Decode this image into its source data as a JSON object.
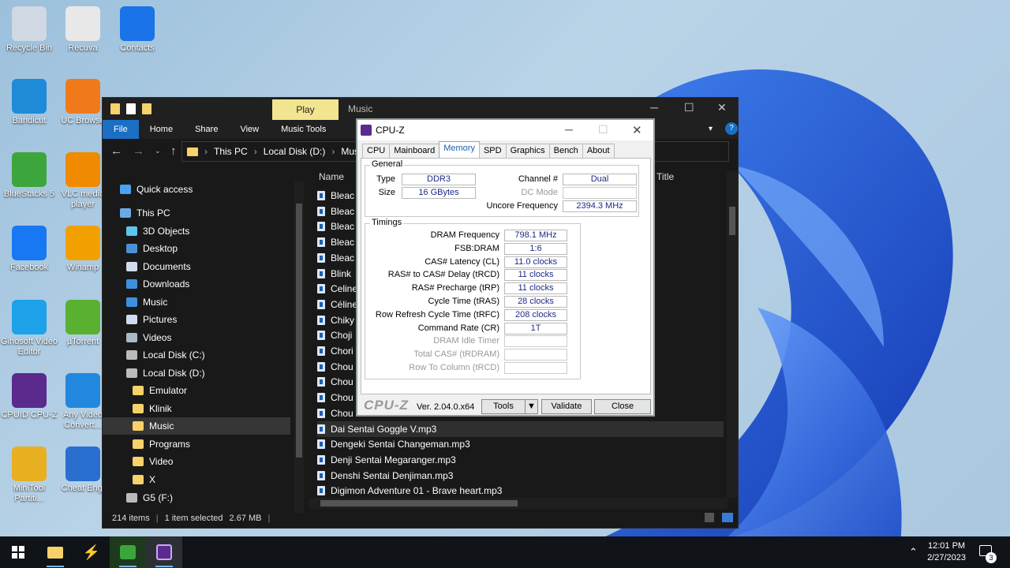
{
  "desktop": {
    "icons": [
      {
        "label": "Recycle Bin",
        "icon": "recycle-bin-icon",
        "color": "#cfd8e3"
      },
      {
        "label": "Recuva",
        "icon": "recuva-icon",
        "color": "#e8e8e8"
      },
      {
        "label": "Contacts",
        "icon": "contacts-icon",
        "color": "#1a73e8"
      },
      {
        "label": "Bandicut",
        "icon": "bandicut-icon",
        "color": "#1f8ad8"
      },
      {
        "label": "UC Browse",
        "icon": "uc-browser-icon",
        "color": "#f07a1a"
      },
      {
        "label": "BlueStacks 5",
        "icon": "bluestacks-icon",
        "color": "#3ca63c"
      },
      {
        "label": "VLC media player",
        "icon": "vlc-icon",
        "color": "#f08a00"
      },
      {
        "label": "Facebook",
        "icon": "facebook-icon",
        "color": "#1877f2"
      },
      {
        "label": "Winamp",
        "icon": "winamp-icon",
        "color": "#f2a000"
      },
      {
        "label": "Gihosoft Video Editor",
        "icon": "gihosoft-icon",
        "color": "#1da1e8"
      },
      {
        "label": "µTorrent",
        "icon": "utorrent-icon",
        "color": "#5ab031"
      },
      {
        "label": "CPUID CPU-Z",
        "icon": "cpuz-icon",
        "color": "#5a2a8c"
      },
      {
        "label": "Any Video Convert...",
        "icon": "any-video-converter-icon",
        "color": "#2288dd"
      },
      {
        "label": "MiniTool Partiti...",
        "icon": "minitool-icon",
        "color": "#e8b020"
      },
      {
        "label": "Cheat Engi",
        "icon": "cheat-engine-icon",
        "color": "#2a6fd0"
      }
    ]
  },
  "explorer": {
    "contextual_tab": "Play",
    "title": "Music",
    "ribbon_tabs": [
      "File",
      "Home",
      "Share",
      "View",
      "Music Tools"
    ],
    "address_parts": [
      "This PC",
      "Local Disk (D:)",
      "Music"
    ],
    "nav": [
      {
        "label": "Quick access",
        "icon": "star-icon",
        "color": "#4aa3f0"
      },
      {
        "label": "This PC",
        "icon": "computer-icon",
        "color": "#6aa9e8"
      },
      {
        "label": "3D Objects",
        "icon": "cube-icon",
        "color": "#5fc4ee"
      },
      {
        "label": "Desktop",
        "icon": "desktop-icon",
        "color": "#4a90d9"
      },
      {
        "label": "Documents",
        "icon": "document-icon",
        "color": "#cfdcef"
      },
      {
        "label": "Downloads",
        "icon": "download-icon",
        "color": "#3f8fe0"
      },
      {
        "label": "Music",
        "icon": "music-icon",
        "color": "#3f8fe0"
      },
      {
        "label": "Pictures",
        "icon": "picture-icon",
        "color": "#cfdcef"
      },
      {
        "label": "Videos",
        "icon": "video-icon",
        "color": "#aab8cc"
      },
      {
        "label": "Local Disk (C:)",
        "icon": "drive-icon",
        "color": "#bbbbbb"
      },
      {
        "label": "Local Disk (D:)",
        "icon": "drive-icon",
        "color": "#bbbbbb"
      },
      {
        "label": "Emulator",
        "icon": "folder-icon",
        "color": "#f7d26a"
      },
      {
        "label": "Klinik",
        "icon": "folder-icon",
        "color": "#f7d26a"
      },
      {
        "label": "Music",
        "icon": "folder-icon",
        "color": "#f7d26a"
      },
      {
        "label": "Programs",
        "icon": "folder-icon",
        "color": "#f7d26a"
      },
      {
        "label": "Video",
        "icon": "folder-icon",
        "color": "#f7d26a"
      },
      {
        "label": "X",
        "icon": "folder-icon",
        "color": "#f7d26a"
      },
      {
        "label": "G5 (F:)",
        "icon": "drive-icon",
        "color": "#bbbbbb"
      }
    ],
    "columns": {
      "name": "Name",
      "title": "Title"
    },
    "files": [
      "Bleac",
      "Bleac",
      "Bleac",
      "Bleac",
      "Bleac",
      "Blink",
      "Celine",
      "Céline",
      "Chiky",
      "Choji",
      "Chori",
      "Chou",
      "Chou",
      "Chou",
      "Chou",
      "Dai Sentai Goggle V.mp3",
      "Dengeki Sentai Changeman.mp3",
      "Denji Sentai Megaranger.mp3",
      "Denshi Sentai Denjiman.mp3",
      "Digimon Adventure 01 - Brave heart.mp3"
    ],
    "status": {
      "items": "214 items",
      "selected": "1 item selected",
      "size": "2.67 MB"
    }
  },
  "cpuz": {
    "title": "CPU-Z",
    "tabs": [
      "CPU",
      "Mainboard",
      "Memory",
      "SPD",
      "Graphics",
      "Bench",
      "About"
    ],
    "active_tab": "Memory",
    "general": {
      "label": "General",
      "type_label": "Type",
      "type": "DDR3",
      "size_label": "Size",
      "size": "16 GBytes",
      "channel_label": "Channel #",
      "channel": "Dual",
      "dc_label": "DC Mode",
      "dc": "",
      "uncore_label": "Uncore Frequency",
      "uncore": "2394.3 MHz"
    },
    "timings": {
      "label": "Timings",
      "rows": [
        {
          "label": "DRAM Frequency",
          "value": "798.1 MHz",
          "enabled": true
        },
        {
          "label": "FSB:DRAM",
          "value": "1:6",
          "enabled": true
        },
        {
          "label": "CAS# Latency (CL)",
          "value": "11.0 clocks",
          "enabled": true
        },
        {
          "label": "RAS# to CAS# Delay (tRCD)",
          "value": "11 clocks",
          "enabled": true
        },
        {
          "label": "RAS# Precharge (tRP)",
          "value": "11 clocks",
          "enabled": true
        },
        {
          "label": "Cycle Time (tRAS)",
          "value": "28 clocks",
          "enabled": true
        },
        {
          "label": "Row Refresh Cycle Time (tRFC)",
          "value": "208 clocks",
          "enabled": true
        },
        {
          "label": "Command Rate (CR)",
          "value": "1T",
          "enabled": true
        },
        {
          "label": "DRAM Idle Timer",
          "value": "",
          "enabled": false
        },
        {
          "label": "Total CAS# (tRDRAM)",
          "value": "",
          "enabled": false
        },
        {
          "label": "Row To Column (tRCD)",
          "value": "",
          "enabled": false
        }
      ]
    },
    "footer": {
      "logo": "CPU-Z",
      "version": "Ver. 2.04.0.x64",
      "tools": "Tools",
      "validate": "Validate",
      "close": "Close"
    }
  },
  "taskbar": {
    "time": "12:01 PM",
    "date": "2/27/2023",
    "notifications": "3"
  }
}
